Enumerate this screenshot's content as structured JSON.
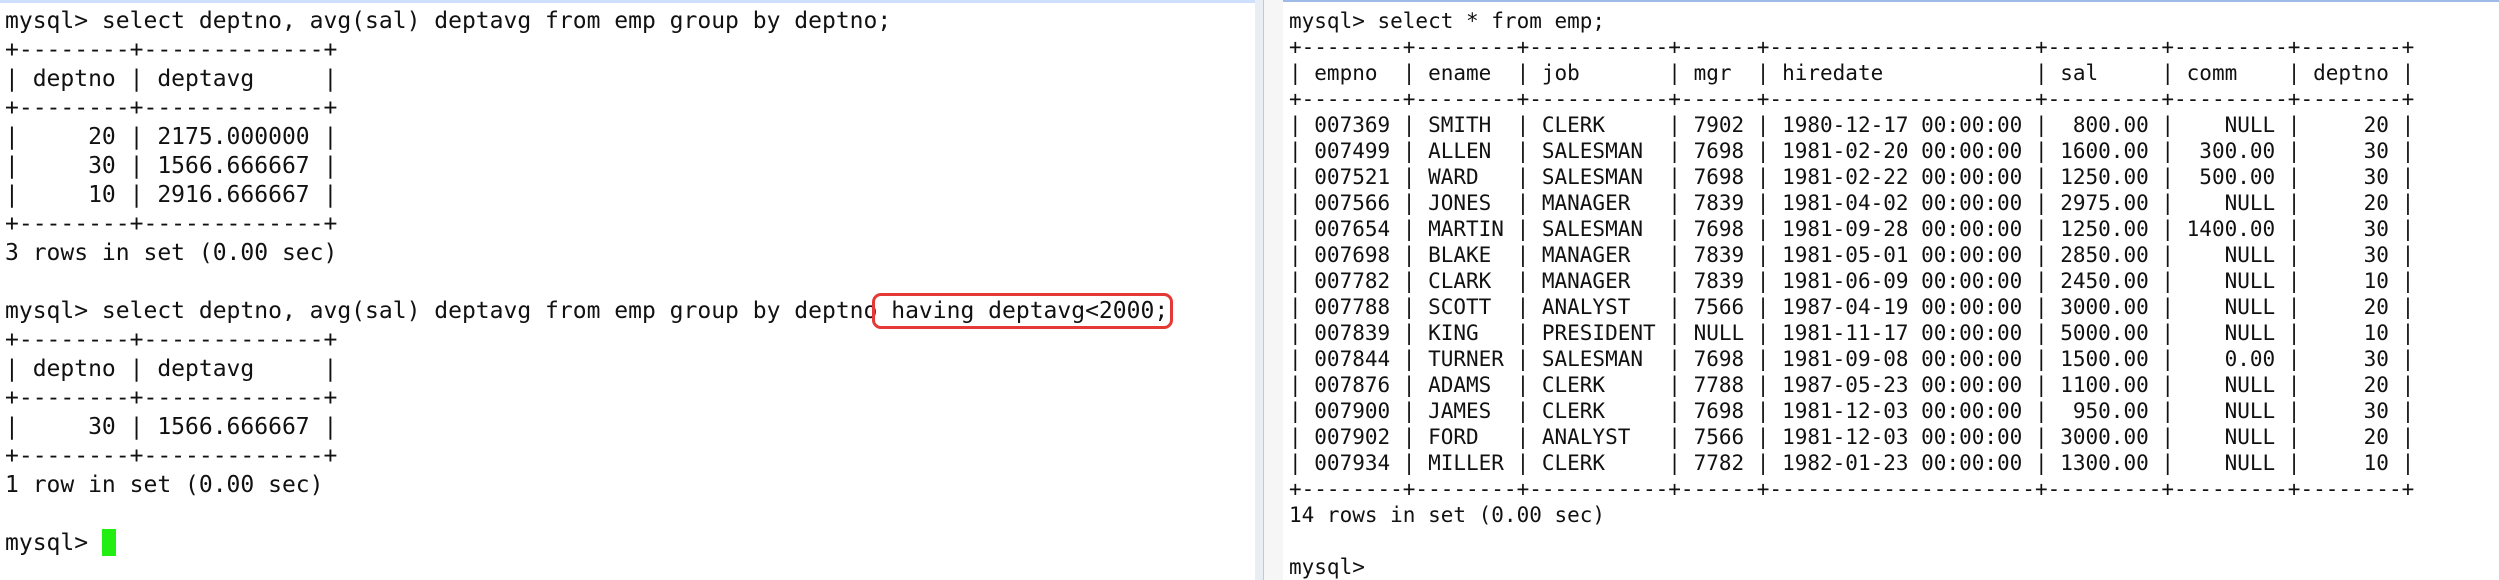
{
  "left_terminal": {
    "lines": [
      "mysql> select deptno, avg(sal) deptavg from emp group by deptno;",
      "+--------+-------------+",
      "| deptno | deptavg     |",
      "+--------+-------------+",
      "|     20 | 2175.000000 |",
      "|     30 | 1566.666667 |",
      "|     10 | 2916.666667 |",
      "+--------+-------------+",
      "3 rows in set (0.00 sec)",
      "",
      "+--------+-------------+",
      "| deptno | deptavg     |",
      "+--------+-------------+",
      "|     30 | 1566.666667 |",
      "+--------+-------------+",
      "1 row in set (0.00 sec)",
      ""
    ],
    "query2_prefix": "mysql> select deptno, avg(sal) deptavg from emp group by deptno",
    "query2_highlight": " having deptavg<2000;",
    "prompt": "mysql> "
  },
  "right_terminal": {
    "lines": [
      "mysql> select * from emp;",
      "+--------+--------+-----------+------+---------------------+---------+---------+--------+",
      "| empno  | ename  | job       | mgr  | hiredate            | sal     | comm    | deptno |",
      "+--------+--------+-----------+------+---------------------+---------+---------+--------+",
      "| 007369 | SMITH  | CLERK     | 7902 | 1980-12-17 00:00:00 |  800.00 |    NULL |     20 |",
      "| 007499 | ALLEN  | SALESMAN  | 7698 | 1981-02-20 00:00:00 | 1600.00 |  300.00 |     30 |",
      "| 007521 | WARD   | SALESMAN  | 7698 | 1981-02-22 00:00:00 | 1250.00 |  500.00 |     30 |",
      "| 007566 | JONES  | MANAGER   | 7839 | 1981-04-02 00:00:00 | 2975.00 |    NULL |     20 |",
      "| 007654 | MARTIN | SALESMAN  | 7698 | 1981-09-28 00:00:00 | 1250.00 | 1400.00 |     30 |",
      "| 007698 | BLAKE  | MANAGER   | 7839 | 1981-05-01 00:00:00 | 2850.00 |    NULL |     30 |",
      "| 007782 | CLARK  | MANAGER   | 7839 | 1981-06-09 00:00:00 | 2450.00 |    NULL |     10 |",
      "| 007788 | SCOTT  | ANALYST   | 7566 | 1987-04-19 00:00:00 | 3000.00 |    NULL |     20 |",
      "| 007839 | KING   | PRESIDENT | NULL | 1981-11-17 00:00:00 | 5000.00 |    NULL |     10 |",
      "| 007844 | TURNER | SALESMAN  | 7698 | 1981-09-08 00:00:00 | 1500.00 |    0.00 |     30 |",
      "| 007876 | ADAMS  | CLERK     | 7788 | 1987-05-23 00:00:00 | 1100.00 |    NULL |     20 |",
      "| 007900 | JAMES  | CLERK     | 7698 | 1981-12-03 00:00:00 |  950.00 |    NULL |     30 |",
      "| 007902 | FORD   | ANALYST   | 7566 | 1981-12-03 00:00:00 | 3000.00 |    NULL |     20 |",
      "| 007934 | MILLER | CLERK     | 7782 | 1982-01-23 00:00:00 | 1300.00 |    NULL |     10 |",
      "+--------+--------+-----------+------+---------------------+---------+---------+--------+",
      "14 rows in set (0.00 sec)",
      "",
      "mysql>"
    ]
  },
  "colors": {
    "highlight_box": "#e53935",
    "cursor": "#22ee11",
    "text": "#111111",
    "background": "#ffffff"
  }
}
